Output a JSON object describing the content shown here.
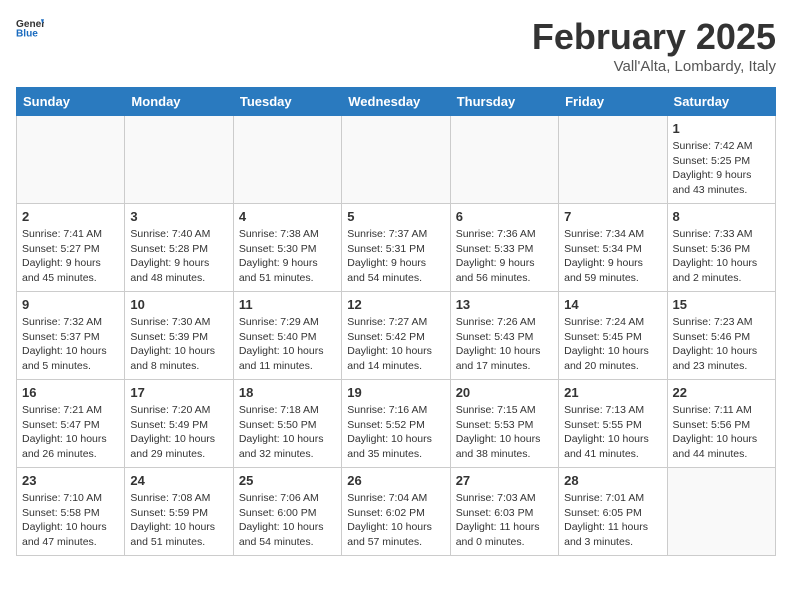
{
  "header": {
    "logo_general": "General",
    "logo_blue": "Blue",
    "title": "February 2025",
    "subtitle": "Vall'Alta, Lombardy, Italy"
  },
  "weekdays": [
    "Sunday",
    "Monday",
    "Tuesday",
    "Wednesday",
    "Thursday",
    "Friday",
    "Saturday"
  ],
  "weeks": [
    [
      {
        "day": "",
        "info": ""
      },
      {
        "day": "",
        "info": ""
      },
      {
        "day": "",
        "info": ""
      },
      {
        "day": "",
        "info": ""
      },
      {
        "day": "",
        "info": ""
      },
      {
        "day": "",
        "info": ""
      },
      {
        "day": "1",
        "info": "Sunrise: 7:42 AM\nSunset: 5:25 PM\nDaylight: 9 hours and 43 minutes."
      }
    ],
    [
      {
        "day": "2",
        "info": "Sunrise: 7:41 AM\nSunset: 5:27 PM\nDaylight: 9 hours and 45 minutes."
      },
      {
        "day": "3",
        "info": "Sunrise: 7:40 AM\nSunset: 5:28 PM\nDaylight: 9 hours and 48 minutes."
      },
      {
        "day": "4",
        "info": "Sunrise: 7:38 AM\nSunset: 5:30 PM\nDaylight: 9 hours and 51 minutes."
      },
      {
        "day": "5",
        "info": "Sunrise: 7:37 AM\nSunset: 5:31 PM\nDaylight: 9 hours and 54 minutes."
      },
      {
        "day": "6",
        "info": "Sunrise: 7:36 AM\nSunset: 5:33 PM\nDaylight: 9 hours and 56 minutes."
      },
      {
        "day": "7",
        "info": "Sunrise: 7:34 AM\nSunset: 5:34 PM\nDaylight: 9 hours and 59 minutes."
      },
      {
        "day": "8",
        "info": "Sunrise: 7:33 AM\nSunset: 5:36 PM\nDaylight: 10 hours and 2 minutes."
      }
    ],
    [
      {
        "day": "9",
        "info": "Sunrise: 7:32 AM\nSunset: 5:37 PM\nDaylight: 10 hours and 5 minutes."
      },
      {
        "day": "10",
        "info": "Sunrise: 7:30 AM\nSunset: 5:39 PM\nDaylight: 10 hours and 8 minutes."
      },
      {
        "day": "11",
        "info": "Sunrise: 7:29 AM\nSunset: 5:40 PM\nDaylight: 10 hours and 11 minutes."
      },
      {
        "day": "12",
        "info": "Sunrise: 7:27 AM\nSunset: 5:42 PM\nDaylight: 10 hours and 14 minutes."
      },
      {
        "day": "13",
        "info": "Sunrise: 7:26 AM\nSunset: 5:43 PM\nDaylight: 10 hours and 17 minutes."
      },
      {
        "day": "14",
        "info": "Sunrise: 7:24 AM\nSunset: 5:45 PM\nDaylight: 10 hours and 20 minutes."
      },
      {
        "day": "15",
        "info": "Sunrise: 7:23 AM\nSunset: 5:46 PM\nDaylight: 10 hours and 23 minutes."
      }
    ],
    [
      {
        "day": "16",
        "info": "Sunrise: 7:21 AM\nSunset: 5:47 PM\nDaylight: 10 hours and 26 minutes."
      },
      {
        "day": "17",
        "info": "Sunrise: 7:20 AM\nSunset: 5:49 PM\nDaylight: 10 hours and 29 minutes."
      },
      {
        "day": "18",
        "info": "Sunrise: 7:18 AM\nSunset: 5:50 PM\nDaylight: 10 hours and 32 minutes."
      },
      {
        "day": "19",
        "info": "Sunrise: 7:16 AM\nSunset: 5:52 PM\nDaylight: 10 hours and 35 minutes."
      },
      {
        "day": "20",
        "info": "Sunrise: 7:15 AM\nSunset: 5:53 PM\nDaylight: 10 hours and 38 minutes."
      },
      {
        "day": "21",
        "info": "Sunrise: 7:13 AM\nSunset: 5:55 PM\nDaylight: 10 hours and 41 minutes."
      },
      {
        "day": "22",
        "info": "Sunrise: 7:11 AM\nSunset: 5:56 PM\nDaylight: 10 hours and 44 minutes."
      }
    ],
    [
      {
        "day": "23",
        "info": "Sunrise: 7:10 AM\nSunset: 5:58 PM\nDaylight: 10 hours and 47 minutes."
      },
      {
        "day": "24",
        "info": "Sunrise: 7:08 AM\nSunset: 5:59 PM\nDaylight: 10 hours and 51 minutes."
      },
      {
        "day": "25",
        "info": "Sunrise: 7:06 AM\nSunset: 6:00 PM\nDaylight: 10 hours and 54 minutes."
      },
      {
        "day": "26",
        "info": "Sunrise: 7:04 AM\nSunset: 6:02 PM\nDaylight: 10 hours and 57 minutes."
      },
      {
        "day": "27",
        "info": "Sunrise: 7:03 AM\nSunset: 6:03 PM\nDaylight: 11 hours and 0 minutes."
      },
      {
        "day": "28",
        "info": "Sunrise: 7:01 AM\nSunset: 6:05 PM\nDaylight: 11 hours and 3 minutes."
      },
      {
        "day": "",
        "info": ""
      }
    ]
  ]
}
